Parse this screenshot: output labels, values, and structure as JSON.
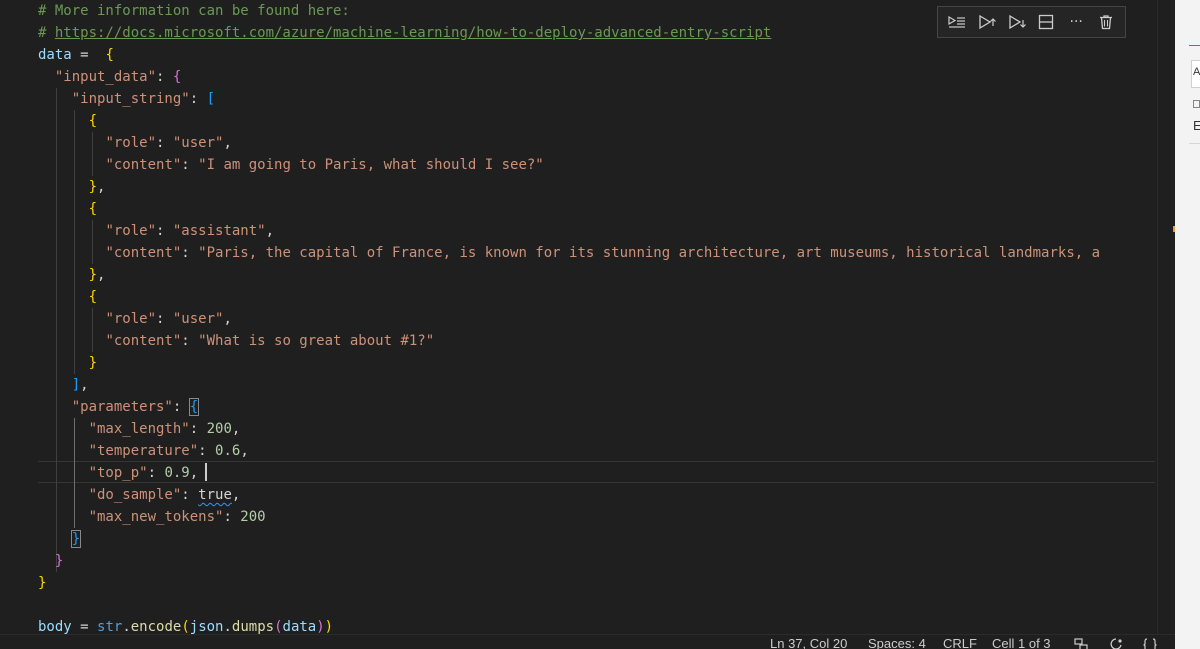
{
  "editor": {
    "comment1": "# More information can be found here:",
    "comment_hash": "# ",
    "doc_url": "https://docs.microsoft.com/azure/machine-learning/how-to-deploy-advanced-entry-script",
    "var_data": "data",
    "op_assign": " = ",
    "key_input_data": "\"input_data\"",
    "key_input_string": "\"input_string\"",
    "key_role": "\"role\"",
    "key_content": "\"content\"",
    "val_user": "\"user\"",
    "val_assistant": "\"assistant\"",
    "msg1_content": "\"I am going to Paris, what should I see?\"",
    "msg2_content": "\"Paris, the capital of France, is known for its stunning architecture, art museums, historical landmarks, a",
    "msg3_content": "\"What is so great about #1?\"",
    "key_parameters": "\"parameters\"",
    "key_max_length": "\"max_length\"",
    "val_max_length": "200",
    "key_temperature": "\"temperature\"",
    "val_temperature": "0.6",
    "key_top_p": "\"top_p\"",
    "val_top_p": "0.9",
    "key_do_sample": "\"do_sample\"",
    "val_do_sample": "true",
    "key_max_new_tokens": "\"max_new_tokens\"",
    "val_max_new_tokens": "200",
    "var_body": "body",
    "fn_str": "str",
    "fn_encode": "encode",
    "fn_json": "json",
    "fn_dumps": "dumps"
  },
  "cell_toolbar": {
    "icons": [
      "execute-above-icon",
      "execute-cell-below-icon",
      "run-below-icon",
      "split-cell-icon",
      "more-actions-icon",
      "delete-cell-icon"
    ],
    "more_label": "···"
  },
  "status_bar": {
    "position": "Ln 37, Col 20",
    "spaces": "Spaces: 4",
    "eol": "CRLF",
    "cell": "Cell 1 of 3"
  },
  "right_panel": {
    "letter_a": "A",
    "letter_e": "E"
  },
  "colors": {
    "background": "#1f1f1f",
    "comment": "#6a9955",
    "string": "#ce9178",
    "number": "#b5cea8",
    "keyword": "#569cd6",
    "variable": "#9cdcfe",
    "function": "#dcdcaa",
    "bracket_gold": "#ffd700",
    "bracket_orchid": "#da70d6",
    "bracket_blue": "#179fff"
  }
}
